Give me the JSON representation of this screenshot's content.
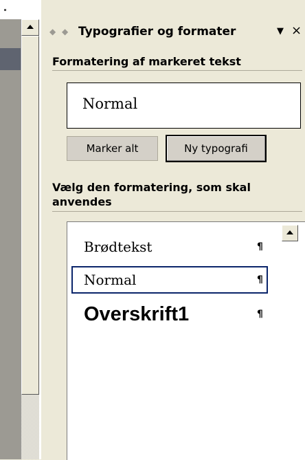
{
  "pane": {
    "title": "Typografier og formater",
    "nav_back_icon": "arrow-left-icon",
    "nav_forward_icon": "arrow-right-icon",
    "dropdown_icon": "triangle-down-icon",
    "close_icon": "close-icon"
  },
  "current_formatting": {
    "heading": "Formatering af markeret tekst",
    "value": "Normal",
    "buttons": {
      "select_all": "Marker alt",
      "new_style": "Ny typografi"
    }
  },
  "apply_formatting": {
    "heading": "Vælg den formatering, som skal anvendes",
    "items": [
      {
        "label": "Brødtekst",
        "mark": "¶",
        "selected": false
      },
      {
        "label": "Normal",
        "mark": "¶",
        "selected": true
      },
      {
        "label": "Overskrift1",
        "mark": "¶",
        "selected": false
      }
    ]
  },
  "colors": {
    "pane_background": "#ece9d8",
    "selection_border": "#0a246a"
  }
}
